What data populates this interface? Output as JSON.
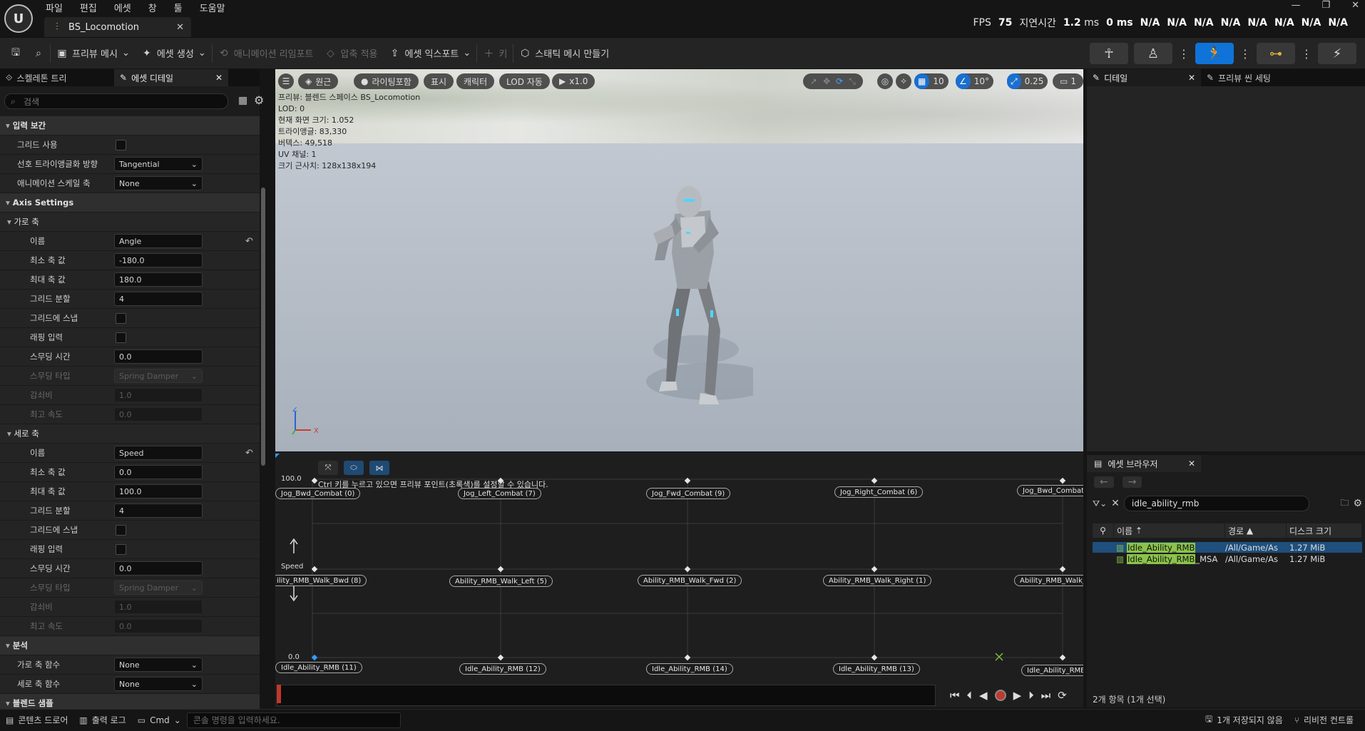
{
  "menu": [
    "파일",
    "편집",
    "에셋",
    "창",
    "툴",
    "도움말"
  ],
  "doc_tab": "BS_Locomotion",
  "stats": {
    "fps_label": "FPS",
    "fps": "75",
    "latency_label": "지연시간",
    "latency_ms": "1.2",
    "latency_unit": "ms",
    "zero_ms": "0 ms",
    "na": [
      "N/A",
      "N/A",
      "N/A",
      "N/A",
      "N/A",
      "N/A",
      "N/A",
      "N/A"
    ]
  },
  "toolbar": {
    "preview_mesh": "프리뷰 메시",
    "create_asset": "에셋 생성",
    "reimport": "애니메이션 리임포트",
    "compress": "압축 적용",
    "export": "에셋 익스포트",
    "key": "키",
    "make_static": "스태틱 메시 만들기"
  },
  "left_tabs": {
    "skeleton_tree": "스켈레톤 트리",
    "asset_details": "에셋 디테일"
  },
  "search_placeholder": "검색",
  "props": {
    "input_interp": "입력 보간",
    "use_grid": "그리드 사용",
    "pref_tri_dir": "선호 트라이앵글화 방향",
    "pref_tri_val": "Tangential",
    "anim_scale_axis": "애니메이션 스케일 축",
    "anim_scale_val": "None",
    "axis_settings": "Axis Settings",
    "h_axis": "가로 축",
    "name": "이름",
    "h_name": "Angle",
    "min": "최소 축 값",
    "h_min": "-180.0",
    "max": "최대 축 값",
    "h_max": "180.0",
    "grid_div": "그리드 분할",
    "h_grid": "4",
    "snap": "그리드에 스냅",
    "wrap": "래핑 입력",
    "smooth_time": "스무딩 시간",
    "h_smooth": "0.0",
    "smooth_type": "스무딩 타입",
    "smooth_type_val": "Spring Damper",
    "damping": "감쇠비",
    "damping_val": "1.0",
    "max_speed": "최고 속도",
    "max_speed_val": "0.0",
    "v_axis": "세로 축",
    "v_name": "Speed",
    "v_min": "0.0",
    "v_max": "100.0",
    "v_grid": "4",
    "v_smooth": "0.0",
    "analysis": "분석",
    "h_func": "가로 축 함수",
    "h_func_val": "None",
    "v_func": "세로 축 함수",
    "v_func_val": "None",
    "blend_samples": "블렌드 샘플"
  },
  "viewport": {
    "btn_perspective": "원근",
    "btn_lit": "라이팅포함",
    "btn_show": "표시",
    "btn_char": "캐릭터",
    "btn_lod": "LOD 자동",
    "btn_speed": "x1.0",
    "grid_snap": "10",
    "rot_snap": "10°",
    "scale_snap": "0.25",
    "cam_speed": "1",
    "info": [
      "프리뷰: 블렌드 스페이스 BS_Locomotion",
      "LOD: 0",
      "현재 화면 크기: 1.052",
      "트라이앵글: 83,330",
      "버텍스: 49,518",
      "UV 채널: 1",
      "크기 근사치: 128x138x194"
    ],
    "axis_z": "Z",
    "axis_x": "X"
  },
  "blend": {
    "y_top": "100.0",
    "y_bottom": "0.0",
    "y_label": "Speed",
    "hint": "Ctrl 키를 누르고 있으면 프리뷰 포인트(초록색)를 설정할 수 있습니다.",
    "nodes_top": [
      "Jog_Bwd_Combat (0)",
      "Jog_Left_Combat (7)",
      "Jog_Fwd_Combat (9)",
      "Jog_Right_Combat (6)",
      "Jog_Bwd_Combat"
    ],
    "nodes_mid": [
      "ility_RMB_Walk_Bwd (8)",
      "Ability_RMB_Walk_Left (5)",
      "Ability_RMB_Walk_Fwd (2)",
      "Ability_RMB_Walk_Right (1)",
      "Ability_RMB_Walk_"
    ],
    "nodes_bot": [
      "Idle_Ability_RMB (11)",
      "Idle_Ability_RMB (12)",
      "Idle_Ability_RMB (14)",
      "Idle_Ability_RMB (13)",
      "Idle_Ability_RMB"
    ]
  },
  "right_tabs": {
    "details": "디테일",
    "preview_scene": "프리뷰 씬 세팅"
  },
  "asset_browser": {
    "tab": "에셋 브라우저",
    "search": "idle_ability_rmb",
    "col_name": "이름",
    "col_path": "경로",
    "col_size": "디스크 크기",
    "rows": [
      {
        "hl": "Idle_Ability_RMB",
        "rest": "",
        "path": "/All/Game/As",
        "size": "1.27 MiB"
      },
      {
        "hl": "Idle_Ability_RMB",
        "rest": "_MSA",
        "path": "/All/Game/As",
        "size": "1.27 MiB"
      }
    ],
    "count": "2개 항목 (1개 선택)"
  },
  "statusbar": {
    "content_drawer": "콘텐츠 드로어",
    "output_log": "출력 로그",
    "cmd": "Cmd",
    "cmd_placeholder": "콘솔 명령을 입력하세요.",
    "unsaved": "1개 저장되지 않음",
    "revision": "리비전 컨트롤"
  }
}
